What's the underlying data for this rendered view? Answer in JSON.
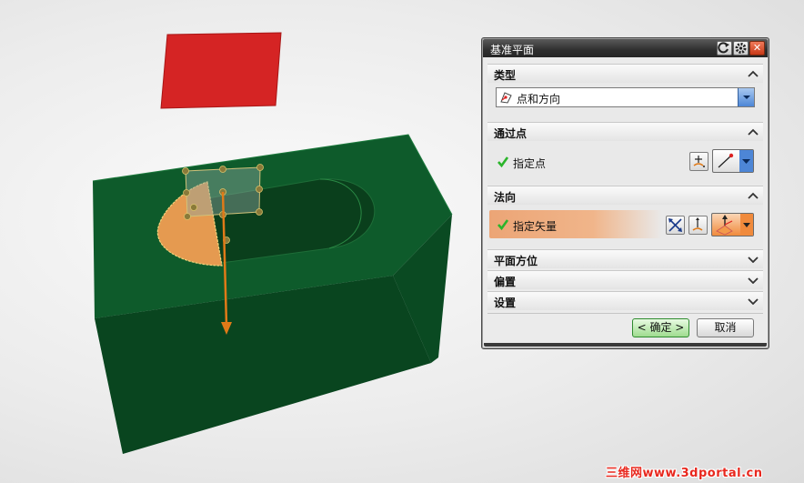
{
  "dialog": {
    "title": "基准平面",
    "sections": {
      "type": {
        "label": "类型",
        "selected": "点和方向"
      },
      "through_point": {
        "label": "通过点",
        "row_label": "指定点"
      },
      "normal": {
        "label": "法向",
        "row_label": "指定矢量"
      },
      "plane_orientation": {
        "label": "平面方位"
      },
      "offset": {
        "label": "偏置"
      },
      "settings": {
        "label": "设置"
      }
    },
    "ok_label": "< 确定 >",
    "cancel_label": "取消"
  },
  "watermark": "三维网www.3dportal.cn",
  "colors": {
    "solid_top": "#0e5a2a",
    "solid_side": "#0b4721",
    "datum_plane": "#d32222",
    "face_highlight": "#e59a50",
    "vector": "#e07a18",
    "check": "#2bb52b",
    "active_row": "#eea878"
  },
  "icons": {
    "close": "close-icon",
    "gear": "gear-icon",
    "reset": "reset-icon",
    "check": "check-icon",
    "chevron_up": "chevron-up-icon",
    "chevron_down": "chevron-down-icon"
  }
}
